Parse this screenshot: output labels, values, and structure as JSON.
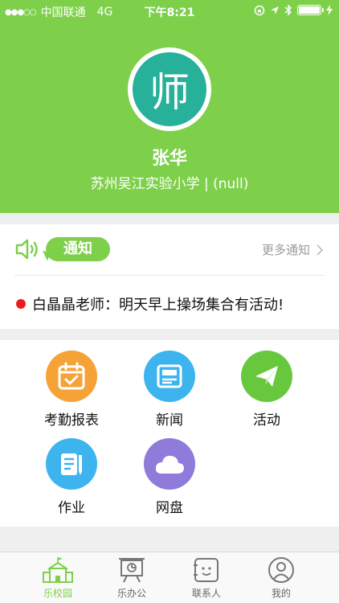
{
  "status_bar": {
    "carrier": "中国联通",
    "network": "4G",
    "time": "下午8:21",
    "signal": "●●●○○"
  },
  "profile": {
    "avatar_char": "师",
    "name": "张华",
    "school": "苏州吴江实验小学 | (null)"
  },
  "notice": {
    "tag": "通知",
    "more": "更多通知",
    "item": "白晶晶老师：明天早上操场集合有活动!"
  },
  "apps": [
    {
      "label": "考勤报表",
      "icon": "calendar-check-icon",
      "color": "#f5a337"
    },
    {
      "label": "新闻",
      "icon": "news-icon",
      "color": "#3db4ee"
    },
    {
      "label": "活动",
      "icon": "paper-plane-icon",
      "color": "#67c83d"
    },
    {
      "label": "作业",
      "icon": "notebook-icon",
      "color": "#3db4ee"
    },
    {
      "label": "网盘",
      "icon": "cloud-icon",
      "color": "#8f7bd9"
    }
  ],
  "tabs": [
    {
      "label": "乐校园",
      "icon": "school-icon",
      "active": true
    },
    {
      "label": "乐办公",
      "icon": "office-icon",
      "active": false
    },
    {
      "label": "联系人",
      "icon": "contacts-icon",
      "active": false
    },
    {
      "label": "我的",
      "icon": "user-icon",
      "active": false
    }
  ],
  "colors": {
    "brand": "#7ed04b",
    "alert": "#ee1b1b"
  }
}
